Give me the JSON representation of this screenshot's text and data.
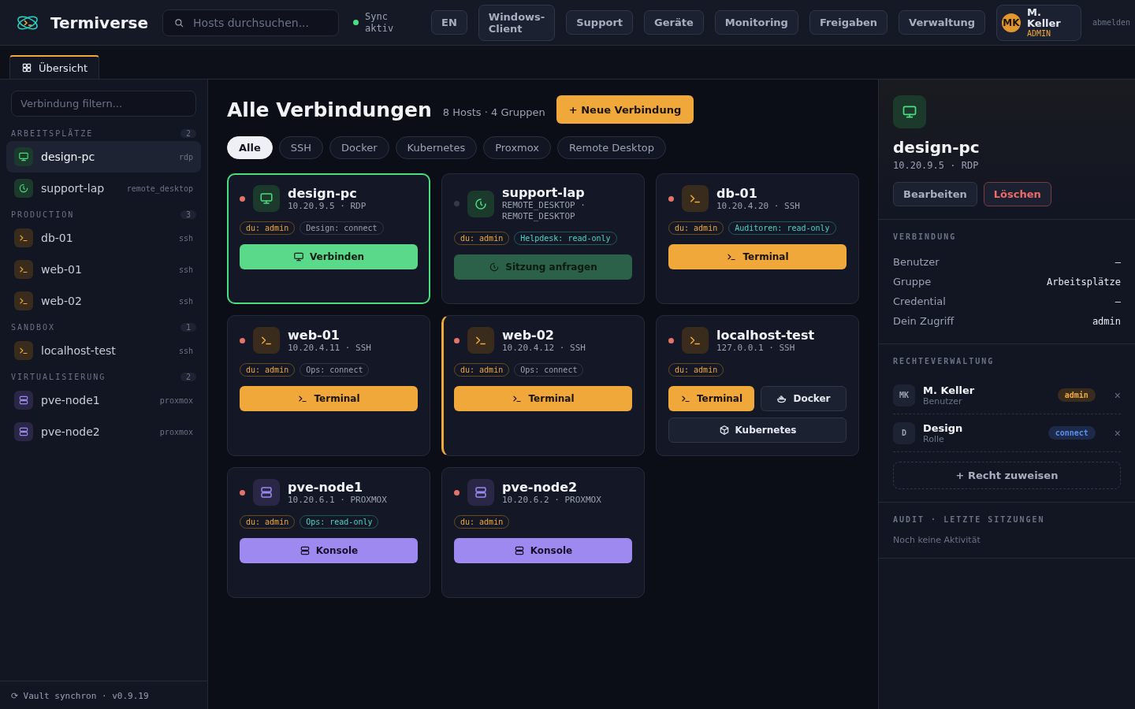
{
  "header": {
    "brand": "Termiverse",
    "search": {
      "placeholder": "Hosts durchsuchen..."
    },
    "sync": {
      "label": "Sync aktiv",
      "color": "#4ade80"
    },
    "language": "EN",
    "nav": [
      "Windows-Client",
      "Support",
      "Geräte",
      "Monitoring",
      "Freigaben",
      "Verwaltung"
    ],
    "user": {
      "initials": "MK",
      "name": "M. Keller",
      "role": "ADMIN"
    },
    "logout": "abmelden"
  },
  "tabs": [
    {
      "label": "Übersicht",
      "selected": true
    }
  ],
  "sidebar": {
    "filter": {
      "placeholder": "Verbindung filtern..."
    },
    "groups": [
      {
        "name": "ARBEITSPLÄTZE",
        "count": "2",
        "items": [
          {
            "name": "design-pc",
            "protocol": "rdp",
            "kind": "rdp",
            "selected": true
          },
          {
            "name": "support-lap",
            "protocol": "remote_desktop",
            "kind": "remote",
            "selected": false
          }
        ]
      },
      {
        "name": "PRODUCTION",
        "count": "3",
        "items": [
          {
            "name": "db-01",
            "protocol": "ssh",
            "kind": "ssh",
            "selected": false
          },
          {
            "name": "web-01",
            "protocol": "ssh",
            "kind": "ssh",
            "selected": false
          },
          {
            "name": "web-02",
            "protocol": "ssh",
            "kind": "ssh",
            "selected": false
          }
        ]
      },
      {
        "name": "SANDBOX",
        "count": "1",
        "items": [
          {
            "name": "localhost-test",
            "protocol": "ssh",
            "kind": "ssh",
            "selected": false
          }
        ]
      },
      {
        "name": "VIRTUALISIERUNG",
        "count": "2",
        "items": [
          {
            "name": "pve-node1",
            "protocol": "proxmox",
            "kind": "proxmox",
            "selected": false
          },
          {
            "name": "pve-node2",
            "protocol": "proxmox",
            "kind": "proxmox",
            "selected": false
          }
        ]
      }
    ],
    "footer": "⟳ Vault synchron · v0.9.19"
  },
  "main": {
    "title": "Alle Verbindungen",
    "summary": "8 Hosts · 4 Gruppen",
    "new_button": "+ Neue Verbindung",
    "filters": [
      {
        "label": "Alle",
        "selected": true
      },
      {
        "label": "SSH",
        "selected": false
      },
      {
        "label": "Docker",
        "selected": false
      },
      {
        "label": "Kubernetes",
        "selected": false
      },
      {
        "label": "Proxmox",
        "selected": false
      },
      {
        "label": "Remote Desktop",
        "selected": false
      }
    ],
    "hosts": [
      {
        "name": "design-pc",
        "address": "10.20.9.5 · RDP",
        "kind": "rdp",
        "color": "#e5736a",
        "selected": true,
        "highlighted": false,
        "tags": [
          {
            "label": "du: admin",
            "kind": "own"
          },
          {
            "label": "Design: connect",
            "kind": "connect"
          }
        ],
        "actions": [
          {
            "label": "Verbinden",
            "kind": "connect"
          }
        ]
      },
      {
        "name": "support-lap",
        "address": "REMOTE_DESKTOP · REMOTE_DESKTOP",
        "kind": "remote",
        "color": "#343a48",
        "selected": false,
        "highlighted": false,
        "tags": [
          {
            "label": "du: admin",
            "kind": "own"
          },
          {
            "label": "Helpdesk: read-only",
            "kind": "readonly"
          }
        ],
        "actions": [
          {
            "label": "Sitzung anfragen",
            "kind": "request"
          }
        ]
      },
      {
        "name": "db-01",
        "address": "10.20.4.20 · SSH",
        "kind": "ssh",
        "color": "#e5736a",
        "selected": false,
        "highlighted": false,
        "tags": [
          {
            "label": "du: admin",
            "kind": "own"
          },
          {
            "label": "Auditoren: read-only",
            "kind": "readonly"
          }
        ],
        "actions": [
          {
            "label": "Terminal",
            "kind": "terminal"
          }
        ]
      },
      {
        "name": "web-01",
        "address": "10.20.4.11 · SSH",
        "kind": "ssh",
        "color": "#e5736a",
        "selected": false,
        "highlighted": false,
        "tags": [
          {
            "label": "du: admin",
            "kind": "own"
          },
          {
            "label": "Ops: connect",
            "kind": "connect"
          }
        ],
        "actions": [
          {
            "label": "Terminal",
            "kind": "terminal"
          }
        ]
      },
      {
        "name": "web-02",
        "address": "10.20.4.12 · SSH",
        "kind": "ssh",
        "color": "#e5736a",
        "selected": false,
        "highlighted": true,
        "tags": [
          {
            "label": "du: admin",
            "kind": "own"
          },
          {
            "label": "Ops: connect",
            "kind": "connect"
          }
        ],
        "actions": [
          {
            "label": "Terminal",
            "kind": "terminal"
          }
        ]
      },
      {
        "name": "localhost-test",
        "address": "127.0.0.1 · SSH",
        "kind": "ssh",
        "color": "#e5736a",
        "selected": false,
        "highlighted": false,
        "tags": [
          {
            "label": "du: admin",
            "kind": "own"
          }
        ],
        "actions": [
          {
            "label": "Terminal",
            "kind": "terminal"
          },
          {
            "label": "Docker",
            "kind": "docker"
          },
          {
            "label": "Kubernetes",
            "kind": "kubernetes"
          }
        ]
      },
      {
        "name": "pve-node1",
        "address": "10.20.6.1 · PROXMOX",
        "kind": "proxmox",
        "color": "#e5736a",
        "selected": false,
        "highlighted": false,
        "tags": [
          {
            "label": "du: admin",
            "kind": "own"
          },
          {
            "label": "Ops: read-only",
            "kind": "readonly"
          }
        ],
        "actions": [
          {
            "label": "Konsole",
            "kind": "console"
          }
        ]
      },
      {
        "name": "pve-node2",
        "address": "10.20.6.2 · PROXMOX",
        "kind": "proxmox",
        "color": "#e5736a",
        "selected": false,
        "highlighted": false,
        "tags": [
          {
            "label": "du: admin",
            "kind": "own"
          }
        ],
        "actions": [
          {
            "label": "Konsole",
            "kind": "console"
          }
        ]
      }
    ]
  },
  "detail": {
    "kind": "rdp",
    "name": "design-pc",
    "address": "10.20.9.5 · RDP",
    "buttons": [
      {
        "label": "Bearbeiten",
        "kind": "default"
      },
      {
        "label": "Löschen",
        "kind": "danger"
      }
    ],
    "connection": {
      "title": "VERBINDUNG",
      "rows": [
        {
          "key": "Benutzer",
          "value": "—"
        },
        {
          "key": "Gruppe",
          "value": "Arbeitsplätze"
        },
        {
          "key": "Credential",
          "value": "—"
        },
        {
          "key": "Dein Zugriff",
          "value": "admin"
        }
      ]
    },
    "permissions": {
      "title": "RECHTEVERWALTUNG",
      "entries": [
        {
          "initials": "MK",
          "name": "M. Keller",
          "type": "Benutzer",
          "badge": "admin",
          "color": "#3a2c1c",
          "remove": "×"
        },
        {
          "initials": "D",
          "name": "Design",
          "type": "Rolle",
          "badge": "connect",
          "color": "#1d2a4a",
          "remove": "×"
        }
      ],
      "add_button": "+ Recht zuweisen"
    },
    "audit": {
      "title": "AUDIT · LETZTE SITZUNGEN",
      "empty": "Noch keine Aktivität"
    }
  }
}
